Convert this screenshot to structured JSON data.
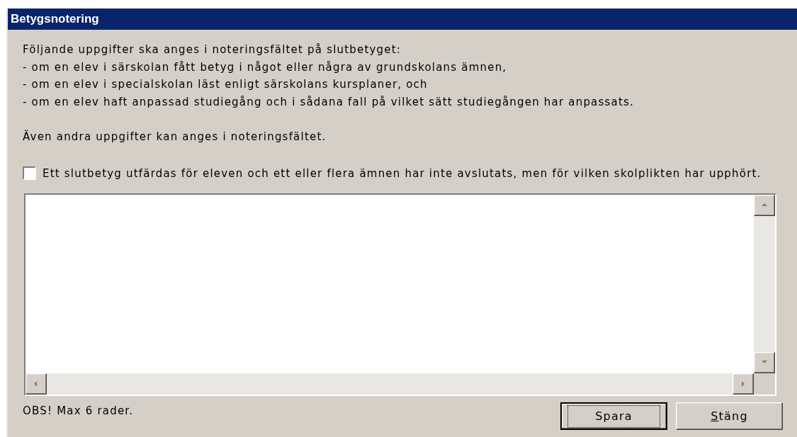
{
  "window": {
    "title": "Betygsnotering"
  },
  "intro_lines": [
    "Följande uppgifter ska anges i noteringsfältet på slutbetyget:",
    "- om en elev i särskolan fått betyg i något eller några av grundskolans ämnen,",
    "- om en elev i specialskolan läst enligt särskolans kursplaner, och",
    "- om en elev haft anpassad studiegång och i sådana fall på vilket sätt studiegången har anpassats."
  ],
  "note": "Även andra uppgifter kan anges i noteringsfältet.",
  "checkbox": {
    "label": "Ett slutbetyg utfärdas för eleven och ett eller flera ämnen har inte avslutats, men för vilken skolplikten har upphört.",
    "checked": false
  },
  "footer_note": "OBS! Max 6 rader.",
  "buttons": [
    {
      "label": "Spara",
      "focused": true,
      "mnemonic_first": false
    },
    {
      "label": "Stäng",
      "focused": false,
      "mnemonic_first": true
    }
  ]
}
